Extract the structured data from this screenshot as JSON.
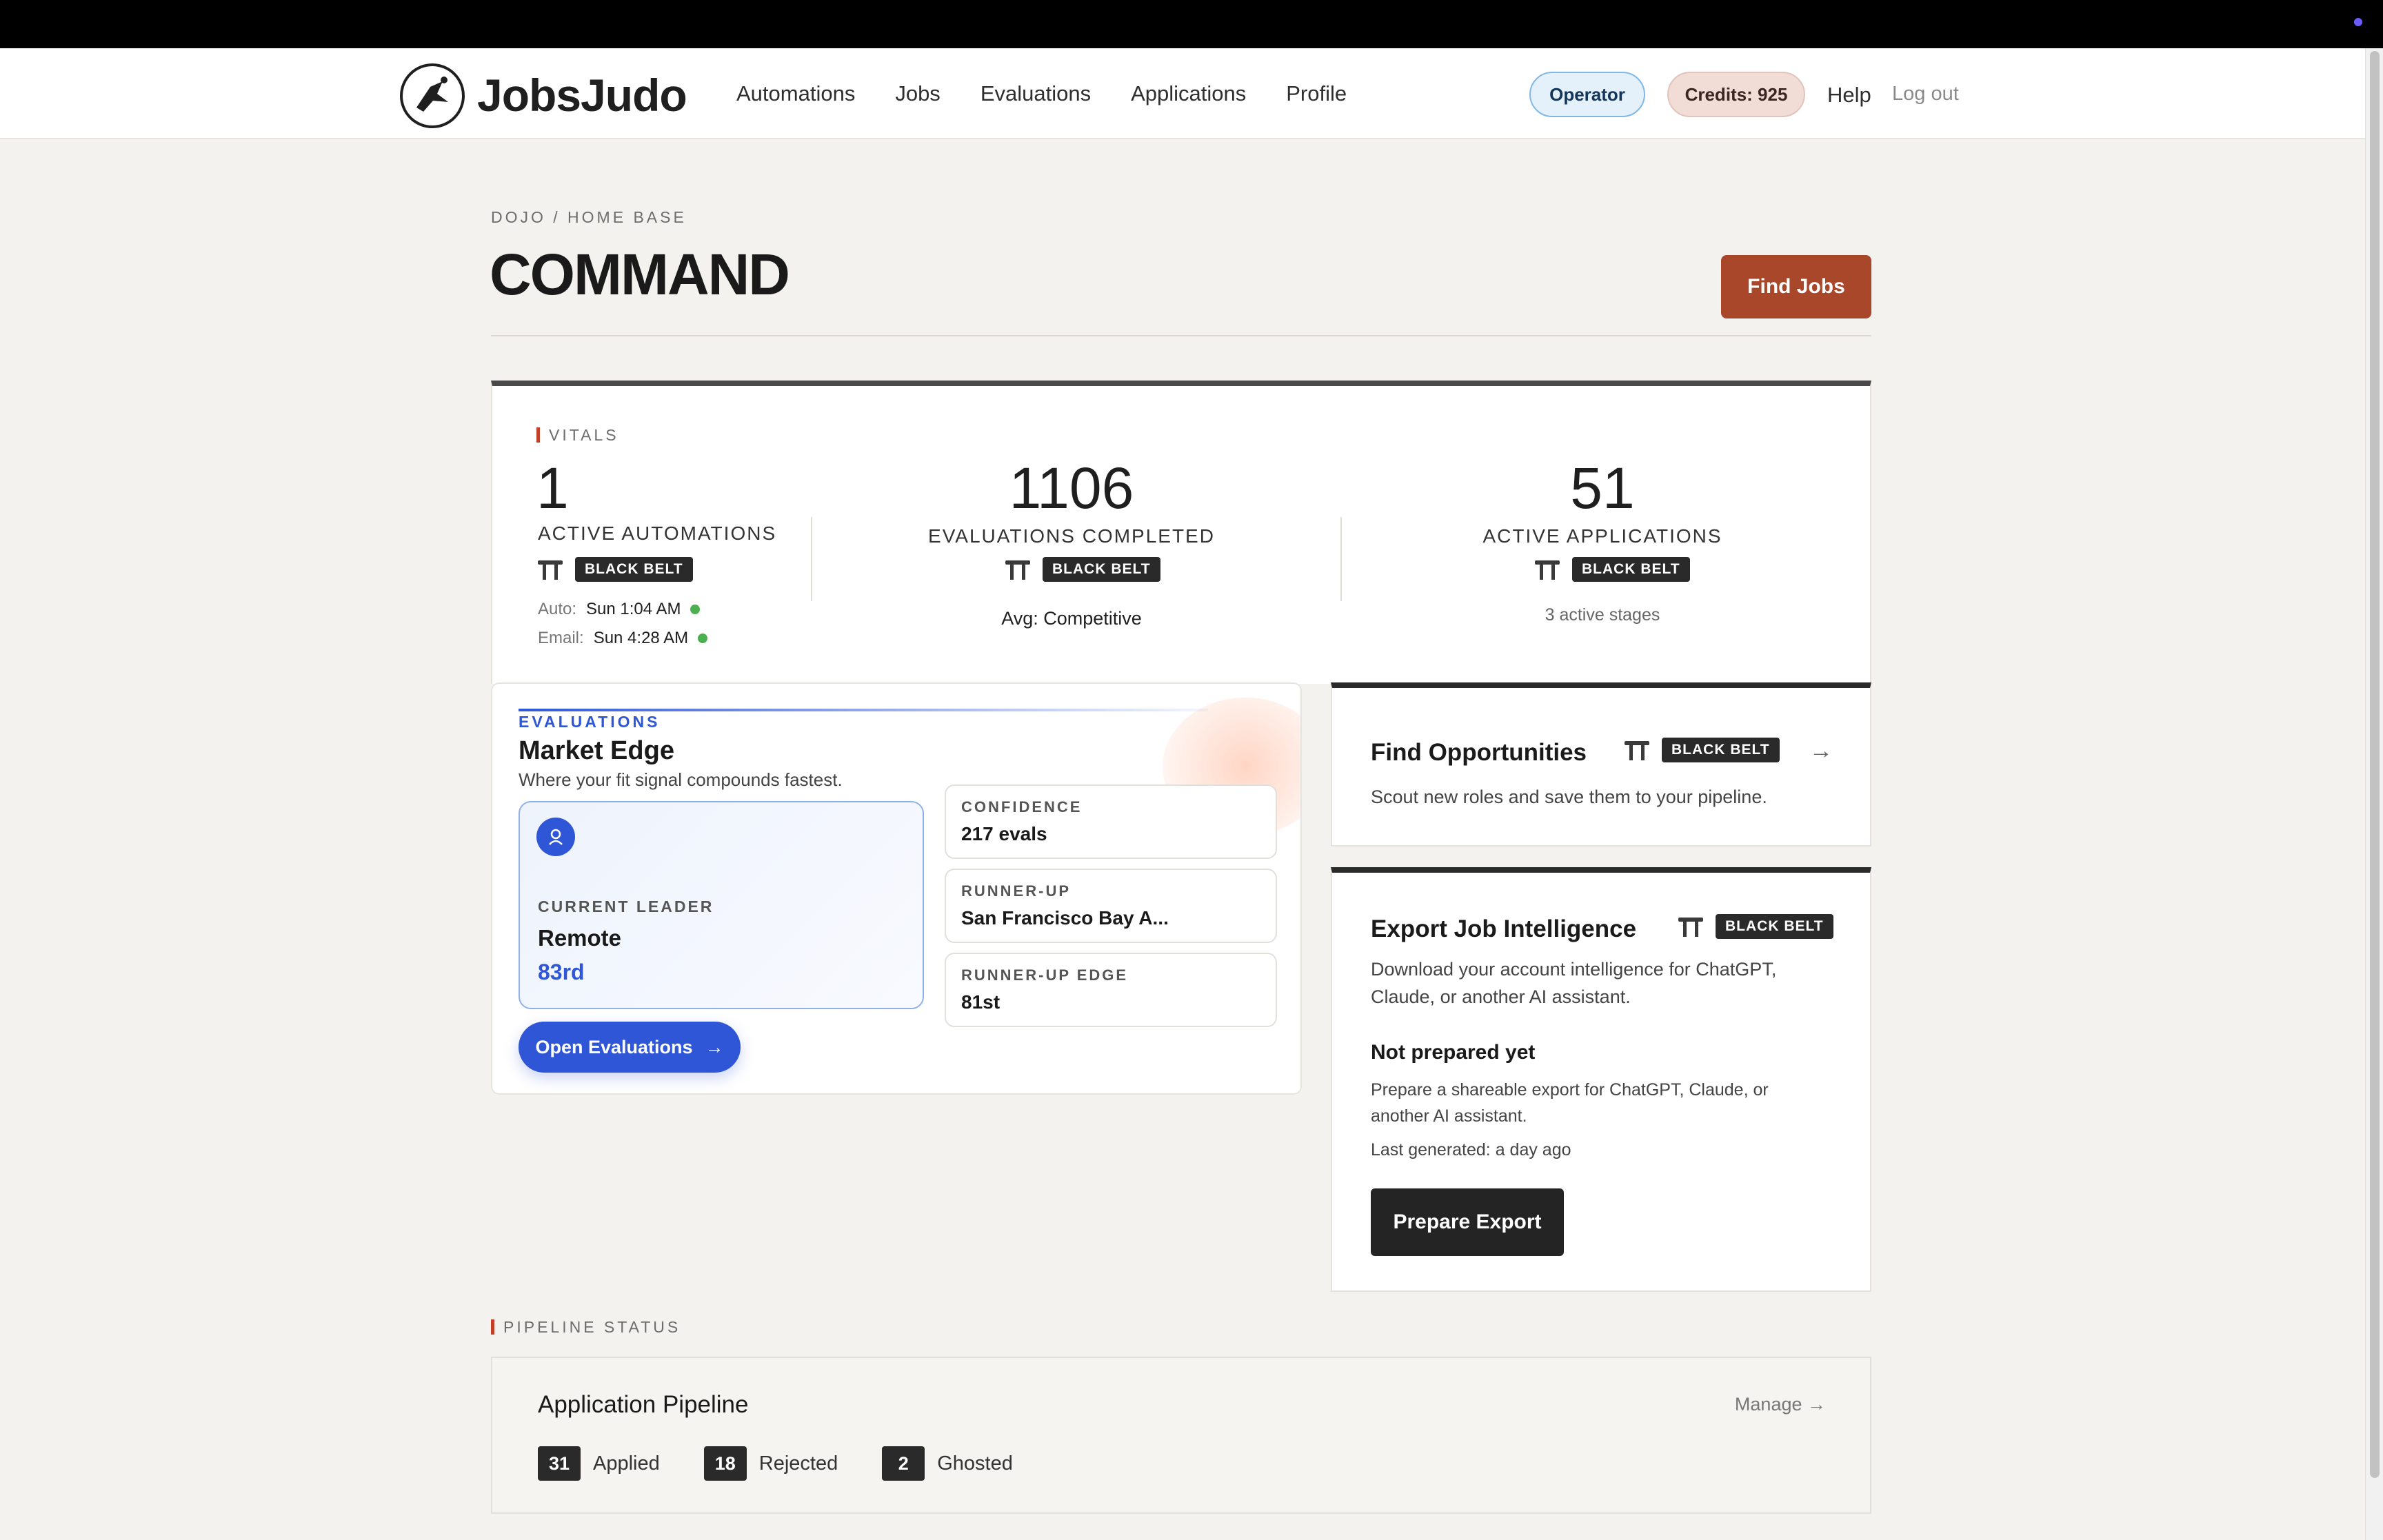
{
  "app": {
    "name": "JobsJudo",
    "nav": [
      "Automations",
      "Jobs",
      "Evaluations",
      "Applications",
      "Profile"
    ],
    "role_chip": "Operator",
    "credits": "Credits: 925",
    "help": "Help",
    "logout": "Log out"
  },
  "header": {
    "breadcrumb": "DOJO / HOME BASE",
    "title": "COMMAND",
    "cta": "Find Jobs"
  },
  "vitals": {
    "label": "VITALS",
    "belt": "BLACK BELT",
    "automations": {
      "value": "1",
      "label": "ACTIVE AUTOMATIONS",
      "auto_key": "Auto:",
      "auto_val": "Sun 1:04 AM",
      "email_key": "Email:",
      "email_val": "Sun 4:28 AM"
    },
    "evaluations": {
      "value": "1106",
      "label": "EVALUATIONS COMPLETED",
      "avg": "Avg: Competitive"
    },
    "applications": {
      "value": "51",
      "label": "ACTIVE APPLICATIONS",
      "stages": "3 active stages"
    }
  },
  "evaluations_card": {
    "kicker": "EVALUATIONS",
    "title": "Market Edge",
    "subtitle": "Where your fit signal compounds fastest.",
    "leader": {
      "label": "CURRENT LEADER",
      "location": "Remote",
      "rank": "83rd"
    },
    "confidence": {
      "label": "CONFIDENCE",
      "value": "217 evals"
    },
    "runner_up": {
      "label": "RUNNER-UP",
      "value": "San Francisco Bay A..."
    },
    "runner_up_edge": {
      "label": "RUNNER-UP EDGE",
      "value": "81st"
    },
    "button": "Open Evaluations",
    "accent": "#2f56d6"
  },
  "find_opportunities": {
    "title": "Find Opportunities",
    "belt": "BLACK BELT",
    "desc": "Scout new roles and save them to your pipeline."
  },
  "export": {
    "title": "Export Job Intelligence",
    "belt": "BLACK BELT",
    "desc1": "Download your account intelligence for ChatGPT,",
    "desc2": "Claude, or another AI assistant.",
    "status_title": "Not prepared yet",
    "status_desc1": "Prepare a shareable export for ChatGPT, Claude, or",
    "status_desc2": "another AI assistant.",
    "last_generated": "Last generated: a day ago",
    "button": "Prepare Export"
  },
  "pipeline": {
    "label": "PIPELINE STATUS",
    "title": "Application Pipeline",
    "manage": "Manage →",
    "counts": [
      {
        "n": "31",
        "label": "Applied"
      },
      {
        "n": "18",
        "label": "Rejected"
      },
      {
        "n": "2",
        "label": "Ghosted"
      }
    ]
  },
  "colors": {
    "brand_cta": "#a8472a",
    "accent_blue": "#2f56d6",
    "status_green": "#4caf50"
  }
}
